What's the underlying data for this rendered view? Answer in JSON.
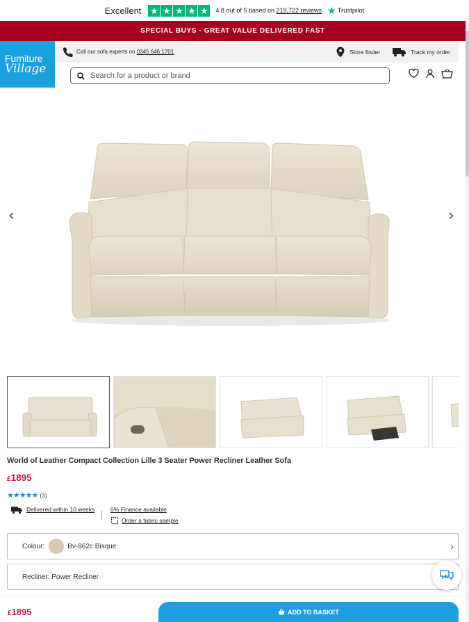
{
  "trustpilot": {
    "rating_word": "Excellent",
    "score_text": "4.8 out of 5 based on",
    "reviews_link": "219,722 reviews",
    "brand": "Trustpilot"
  },
  "promo": {
    "text": "SPECIAL BUYS - GREAT VALUE DELIVERED FAST"
  },
  "header": {
    "logo_line1": "Furniture",
    "logo_line2": "Village",
    "call_prefix": "Call our",
    "call_bold": "sofa experts",
    "call_on": "on",
    "phone": "0345 646 1701",
    "store_finder": "Store finder",
    "track_order": "Track my order",
    "search_placeholder": "Search for a product or brand"
  },
  "gallery": {
    "prev": "‹",
    "next": "›",
    "thumbnail_count": 5,
    "active_index": 0
  },
  "product": {
    "title": "World of Leather Compact Collection Lille 3 Seater Power Recliner Leather Sofa",
    "currency": "£",
    "price": "1895",
    "stars": "★★★★★",
    "rating": 5,
    "review_count": "(3)",
    "delivery": "Delivered within 10 weeks",
    "finance": "0% Finance available",
    "sample": "Order a fabric sample"
  },
  "options": {
    "colour_label": "Colour:",
    "colour_value": "Bv-862c Bisque",
    "colour_swatch": "#d8c9ae",
    "recliner": "Recliner: Power Recliner"
  },
  "footer": {
    "currency": "£",
    "price": "1895",
    "basket_label": "ADD TO BASKET"
  },
  "colors": {
    "promo_bg": "#a6001e",
    "brand_blue": "#1ba1e2",
    "price_red": "#c8174c",
    "trust_green": "#00b67a"
  }
}
